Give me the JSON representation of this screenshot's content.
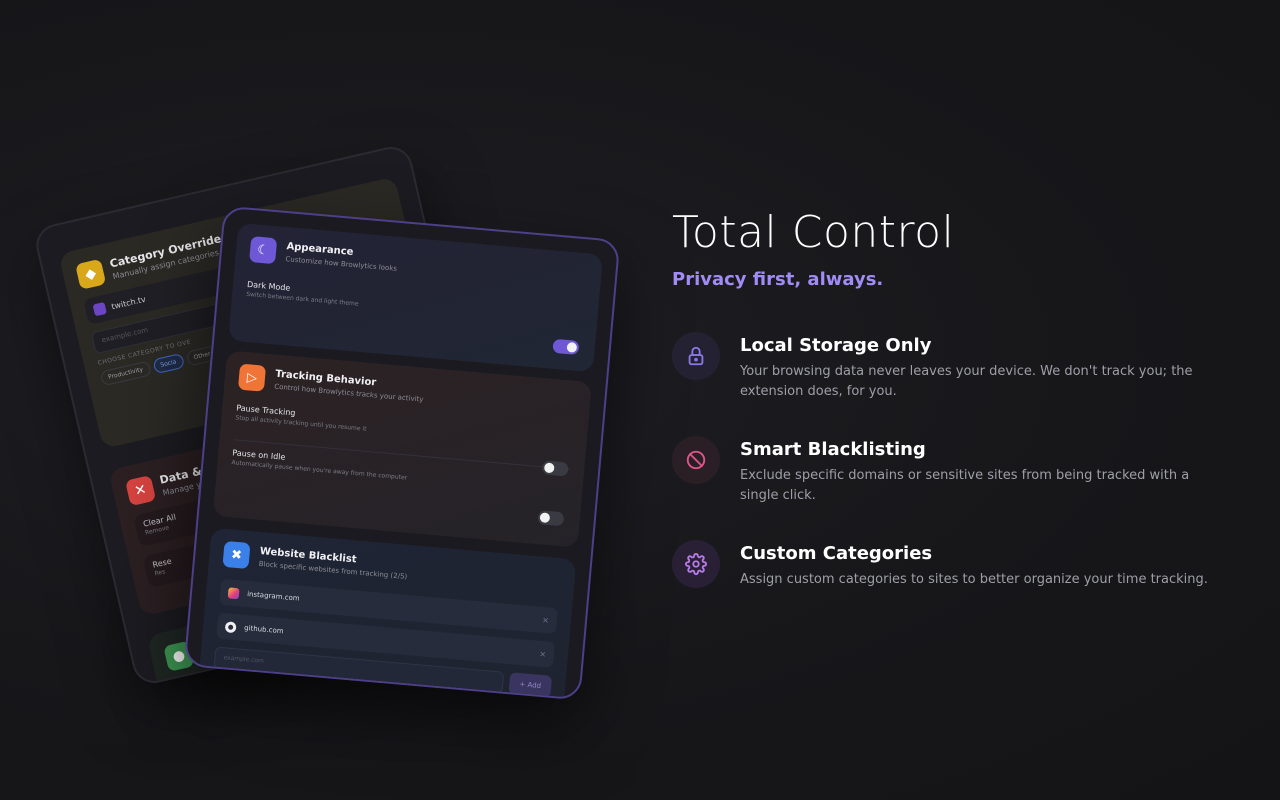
{
  "hero": {
    "title": "Total Control",
    "subtitle": "Privacy first, always."
  },
  "features": [
    {
      "icon": "lock-icon",
      "title": "Local Storage Only",
      "description": "Your browsing data never leaves your device. We don't track you; the extension does, for you."
    },
    {
      "icon": "ban-icon",
      "title": "Smart Blacklisting",
      "description": "Exclude specific domains or sensitive sites from being tracked with a single click."
    },
    {
      "icon": "gear-icon",
      "title": "Custom Categories",
      "description": "Assign custom categories to sites to better organize your time tracking."
    }
  ],
  "back_card": {
    "category": {
      "title": "Category Overrides",
      "subtitle": "Manually assign categories to",
      "site": "twitch.tv",
      "input_placeholder": "example.com",
      "choose_label": "CHOOSE CATEGORY TO OVE",
      "chips": [
        "Productivity",
        "Socia",
        "Other"
      ]
    },
    "data": {
      "title": "Data & P",
      "subtitle": "Manage y",
      "clear_title": "Clear All",
      "clear_sub": "Remove",
      "reset_title": "Rese",
      "reset_sub": "Res"
    }
  },
  "front_card": {
    "appearance": {
      "title": "Appearance",
      "subtitle": "Customize how Browlytics looks",
      "dark_mode_title": "Dark Mode",
      "dark_mode_sub": "Switch between dark and light theme"
    },
    "tracking": {
      "title": "Tracking Behavior",
      "subtitle": "Control how Browlytics tracks your activity",
      "pause_title": "Pause Tracking",
      "pause_sub": "Stop all activity tracking until you resume it",
      "idle_title": "Pause on Idle",
      "idle_sub": "Automatically pause when you're away from the computer"
    },
    "blacklist": {
      "title": "Website Blacklist",
      "subtitle": "Block specific websites from tracking (2/5)",
      "sites": [
        "instagram.com",
        "github.com"
      ],
      "input_placeholder": "example.com",
      "add_label": "+ Add"
    }
  },
  "colors": {
    "accent": "#a18cf5",
    "toggle_on": "#6e58d6"
  }
}
